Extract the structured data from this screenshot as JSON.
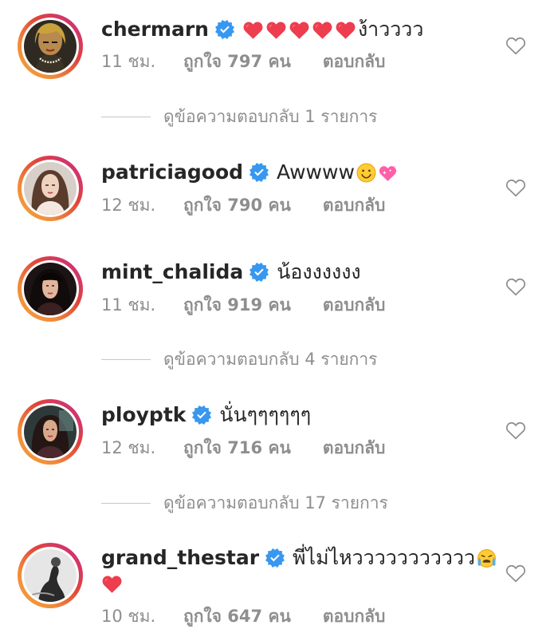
{
  "colors": {
    "text": "#262626",
    "secondary": "#8e8e8e",
    "verified": "#3897f0",
    "heart_red": "#ed4956",
    "story_ring": "#e0453a"
  },
  "icons": {
    "verified": "verified-badge-icon",
    "like": "heart-outline-icon"
  },
  "comments": [
    {
      "username": "chermarn",
      "text": "ง้าวววว",
      "emoji_before_text": [
        "red-heart",
        "red-heart",
        "red-heart",
        "red-heart",
        "red-heart"
      ],
      "time": "11 ชม.",
      "likes": "ถูกใจ 797 คน",
      "reply": "ตอบกลับ",
      "view_replies": "ดูข้อความตอบกลับ 1 รายการ"
    },
    {
      "username": "patriciagood",
      "text": "Awwww",
      "emoji_after_text": [
        "smiling-face",
        "sparkling-heart"
      ],
      "time": "12 ชม.",
      "likes": "ถูกใจ 790 คน",
      "reply": "ตอบกลับ"
    },
    {
      "username": "mint_chalida",
      "text": "น้องงงงงง",
      "time": "11 ชม.",
      "likes": "ถูกใจ 919 คน",
      "reply": "ตอบกลับ",
      "view_replies": "ดูข้อความตอบกลับ 4 รายการ"
    },
    {
      "username": "ployptk",
      "text": "นั่นๆๆๆๆๆๆ",
      "time": "12 ชม.",
      "likes": "ถูกใจ 716 คน",
      "reply": "ตอบกลับ",
      "view_replies": "ดูข้อความตอบกลับ 17 รายการ"
    },
    {
      "username": "grand_thestar",
      "text": "พี่ไม่ไหววววววววววว",
      "emoji_after_text": [
        "loudly-crying-face"
      ],
      "emoji_second_line": [
        "red-heart"
      ],
      "time": "10 ชม.",
      "likes": "ถูกใจ 647 คน",
      "reply": "ตอบกลับ"
    }
  ]
}
